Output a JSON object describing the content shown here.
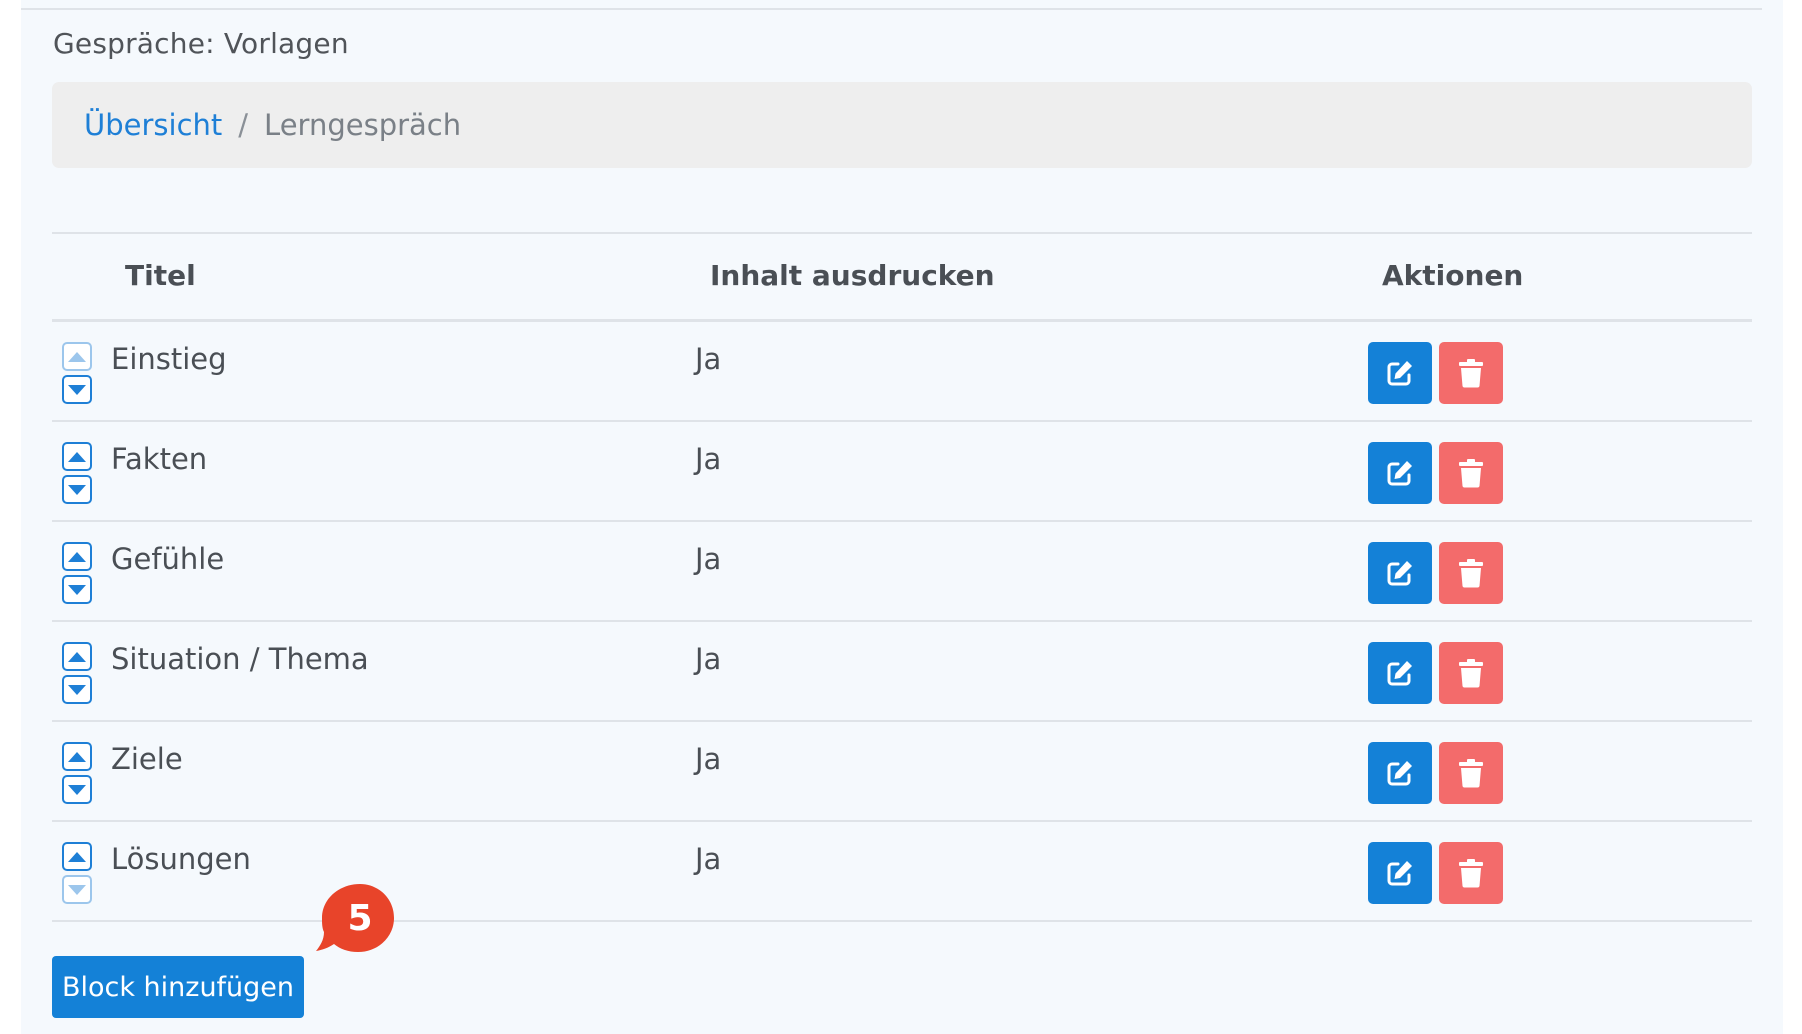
{
  "page": {
    "title": "Gespräche: Vorlagen"
  },
  "breadcrumb": {
    "link": "Übersicht",
    "separator": "/",
    "current": "Lerngespräch"
  },
  "table": {
    "headers": {
      "title": "Titel",
      "print": "Inhalt ausdrucken",
      "actions": "Aktionen"
    },
    "rows": [
      {
        "title": "Einstieg",
        "print": "Ja",
        "move_up_enabled": false,
        "move_down_enabled": true
      },
      {
        "title": "Fakten",
        "print": "Ja",
        "move_up_enabled": true,
        "move_down_enabled": true
      },
      {
        "title": "Gefühle",
        "print": "Ja",
        "move_up_enabled": true,
        "move_down_enabled": true
      },
      {
        "title": "Situation / Thema",
        "print": "Ja",
        "move_up_enabled": true,
        "move_down_enabled": true
      },
      {
        "title": "Ziele",
        "print": "Ja",
        "move_up_enabled": true,
        "move_down_enabled": true
      },
      {
        "title": "Lösungen",
        "print": "Ja",
        "move_up_enabled": true,
        "move_down_enabled": false
      }
    ],
    "row_icons": {
      "move_up": "caret-up-icon",
      "move_down": "caret-down-icon",
      "edit": "edit-icon",
      "delete": "trash-icon"
    }
  },
  "add_block_button": "Block hinzufügen",
  "step_badge": "5",
  "colors": {
    "primary": "#1481d7",
    "danger": "#f36b6b",
    "badge": "#e8442a",
    "link": "#1e7fd6"
  }
}
